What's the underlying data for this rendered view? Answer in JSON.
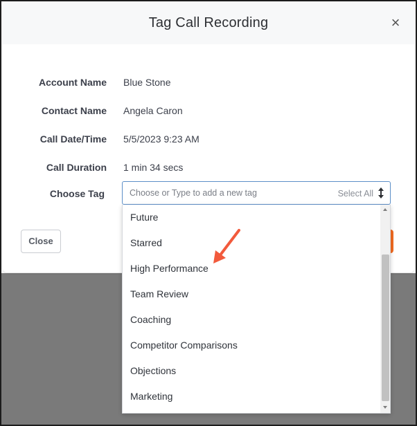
{
  "modal": {
    "title": "Tag Call Recording",
    "close_icon": "close-icon"
  },
  "fields": [
    {
      "label": "Account Name",
      "value": "Blue Stone"
    },
    {
      "label": "Contact Name",
      "value": "Angela Caron"
    },
    {
      "label": "Call Date/Time",
      "value": "5/5/2023 9:23 AM"
    },
    {
      "label": "Call Duration",
      "value": "1 min 34 secs"
    }
  ],
  "tag": {
    "label": "Choose Tag",
    "placeholder": "Choose or Type to add a new tag",
    "select_all": "Select All",
    "sort_icon": "sort-up-down-icon"
  },
  "dropdown": {
    "options": [
      "Future",
      "Starred",
      "High Performance",
      "Team Review",
      "Coaching",
      "Competitor Comparisons",
      "Objections",
      "Marketing"
    ],
    "highlighted": "High Performance"
  },
  "footer": {
    "close_label": "Close"
  },
  "colors": {
    "accent_orange": "#f26b21",
    "annotation_arrow": "#f25a3c",
    "input_border": "#5b8ec7",
    "overlay": "#7a7a7a"
  }
}
